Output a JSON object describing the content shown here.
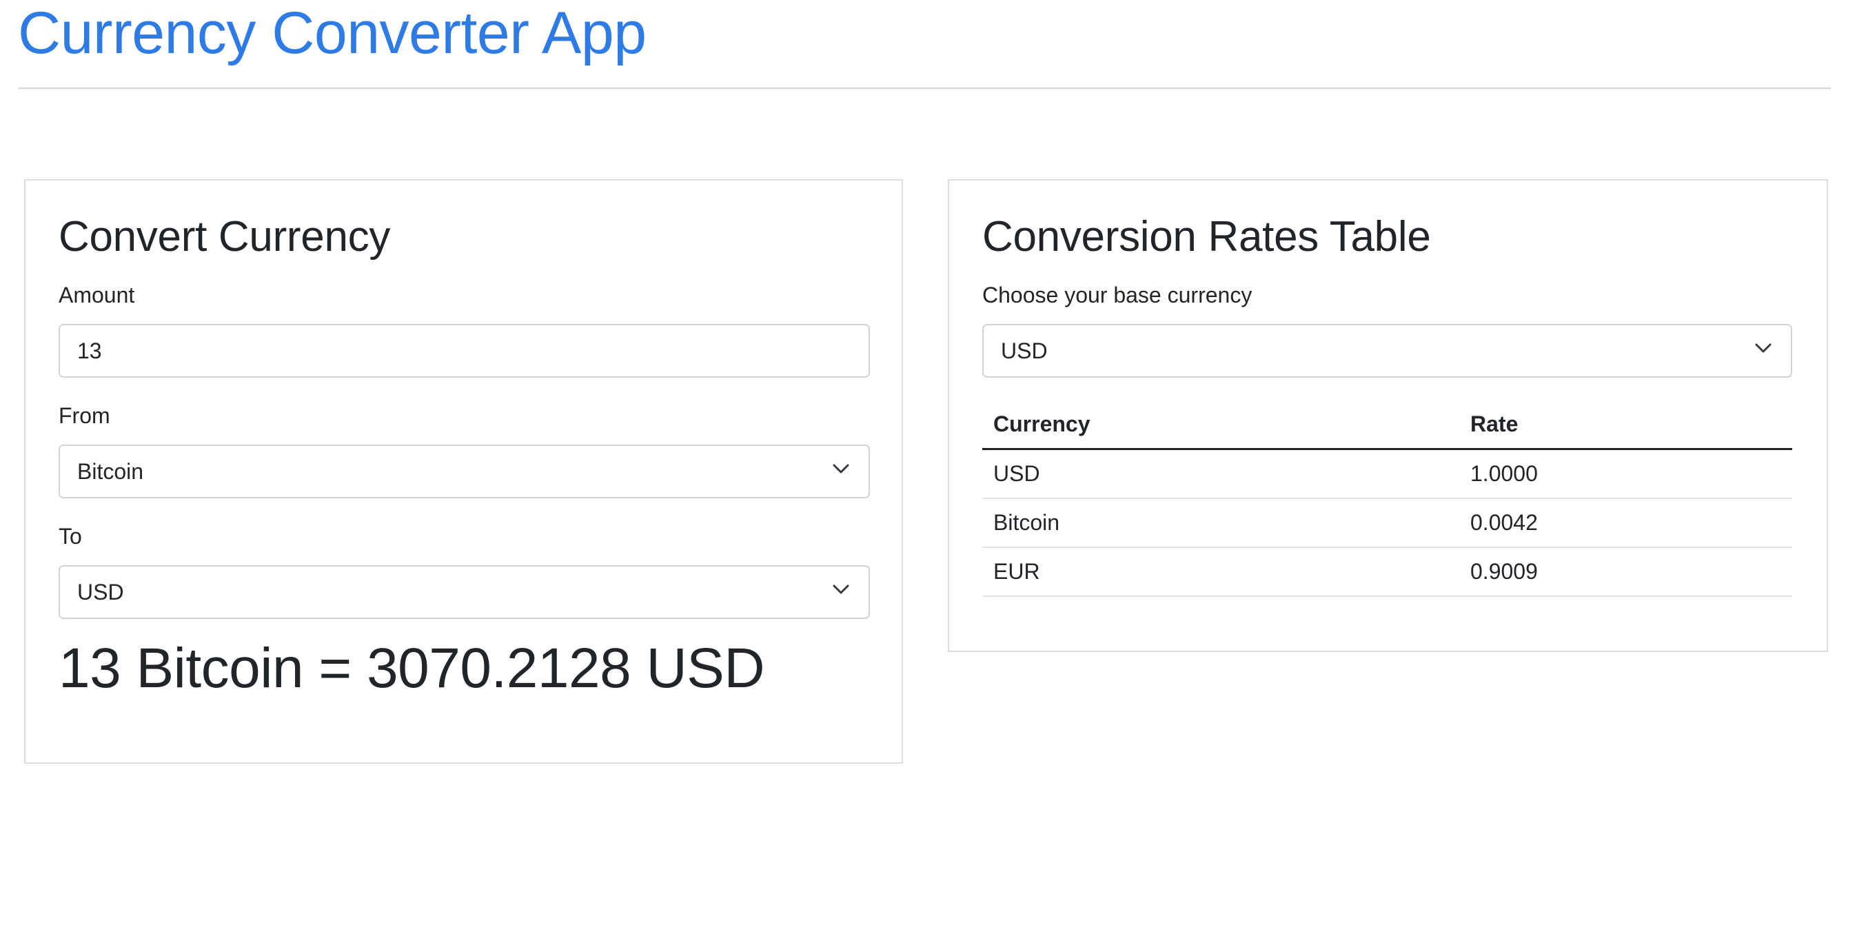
{
  "app": {
    "title": "Currency Converter App"
  },
  "convert": {
    "title": "Convert Currency",
    "amount_label": "Amount",
    "amount_value": "13",
    "from_label": "From",
    "from_value": "Bitcoin",
    "to_label": "To",
    "to_value": "USD",
    "result": "13 Bitcoin = 3070.2128 USD"
  },
  "rates": {
    "title": "Conversion Rates Table",
    "base_label": "Choose your base currency",
    "base_value": "USD",
    "columns": [
      "Currency",
      "Rate"
    ],
    "rows": [
      {
        "currency": "USD",
        "rate": "1.0000"
      },
      {
        "currency": "Bitcoin",
        "rate": "0.0042"
      },
      {
        "currency": "EUR",
        "rate": "0.9009"
      }
    ]
  },
  "icons": {
    "select_indicator": "chevron-down-icon"
  },
  "colors": {
    "brand": "#2f7be5",
    "text": "#212529",
    "border": "#ced4da"
  }
}
